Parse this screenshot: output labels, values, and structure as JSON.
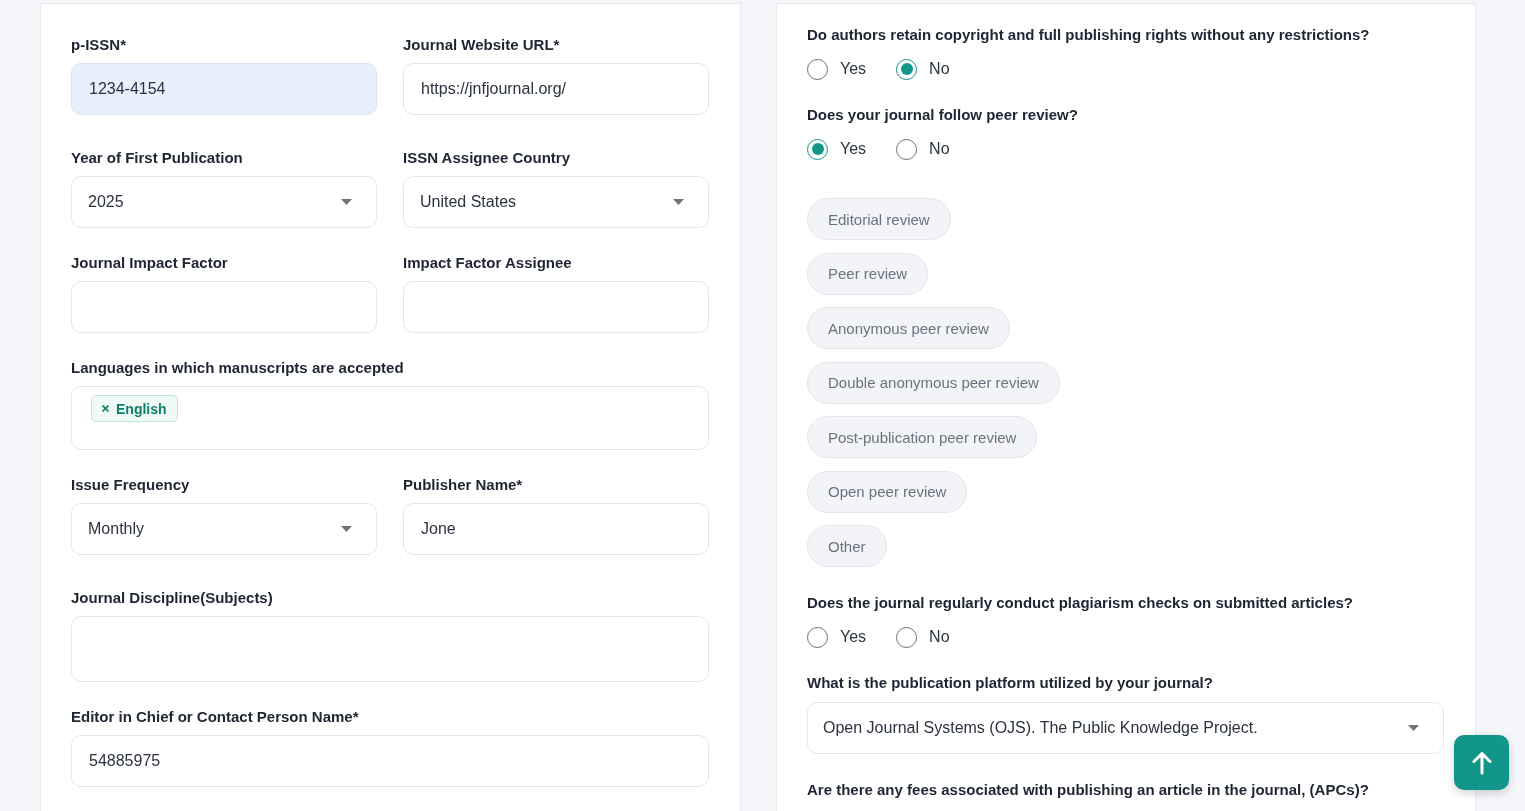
{
  "left_form": {
    "rows": [
      [
        {
          "kind": "text",
          "label": "p-ISSN*",
          "value": "1234-4154",
          "autofilled": true
        },
        {
          "kind": "text",
          "label": "Journal Website URL*",
          "value": "https://jnfjournal.org/",
          "autofilled": false
        }
      ],
      [
        {
          "kind": "select",
          "label": "Year of First Publication",
          "value": "2025"
        },
        {
          "kind": "select",
          "label": "ISSN Assignee Country",
          "value": "United States"
        }
      ],
      [
        {
          "kind": "text",
          "label": "Journal Impact Factor",
          "autofilled": false
        },
        {
          "kind": "text",
          "label": "Impact Factor Assignee",
          "autofilled": false
        }
      ],
      [
        {
          "kind": "tags",
          "label": "Languages in which manuscripts are accepted",
          "tags": [
            "English"
          ]
        }
      ],
      [
        {
          "kind": "select",
          "label": "Issue Frequency",
          "value": "Monthly"
        },
        {
          "kind": "text",
          "label": "Publisher Name*",
          "value": "Jone",
          "autofilled": false
        }
      ],
      [
        {
          "kind": "textarea",
          "label": "Journal Discipline(Subjects)"
        }
      ],
      [
        {
          "kind": "text",
          "label": "Editor in Chief or Contact Person Name*",
          "value": "54885975",
          "autofilled": false
        }
      ]
    ]
  },
  "right_panel": {
    "questions": [
      {
        "kind": "radio",
        "question": "Do authors retain copyright and full publishing rights without any restrictions?",
        "options": [
          {
            "label": "Yes",
            "selected": false
          },
          {
            "label": "No",
            "selected": true
          }
        ]
      },
      {
        "kind": "radio",
        "question": "Does your journal follow peer review?",
        "options": [
          {
            "label": "Yes",
            "selected": true
          },
          {
            "label": "No",
            "selected": false
          }
        ],
        "review_types": [
          {
            "label": "Editorial review",
            "selected": false
          },
          {
            "label": "Peer review",
            "selected": false
          },
          {
            "label": "Anonymous peer review",
            "selected": false
          },
          {
            "label": "Double anonymous peer review",
            "selected": false
          },
          {
            "label": "Post-publication peer review",
            "selected": false
          },
          {
            "label": "Open peer review",
            "selected": false
          },
          {
            "label": "Other",
            "selected": false
          }
        ]
      },
      {
        "kind": "radio",
        "question": "Does the journal regularly conduct plagiarism checks on submitted articles?",
        "options": [
          {
            "label": "Yes",
            "selected": false
          },
          {
            "label": "No",
            "selected": false
          }
        ]
      },
      {
        "kind": "select",
        "question": "What is the publication platform utilized by your journal?",
        "value": "Open Journal Systems (OJS). The Public Knowledge Project."
      },
      {
        "kind": "plain",
        "question": "Are there any fees associated with publishing an article in the journal, (APCs)?"
      }
    ]
  }
}
